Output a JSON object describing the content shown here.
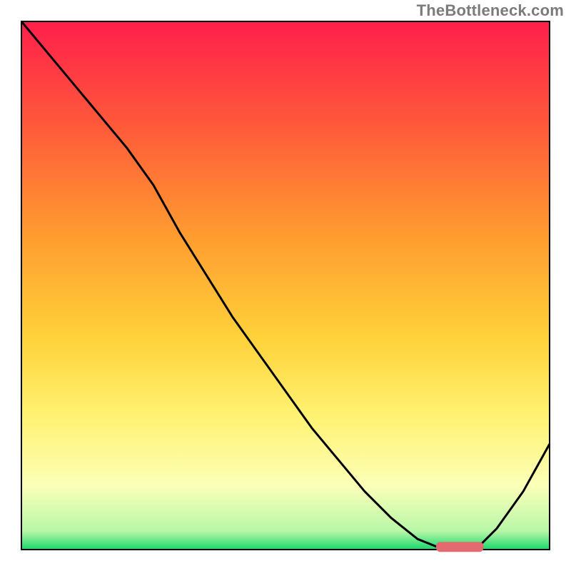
{
  "watermark": "TheBottleneck.com",
  "chart_data": {
    "type": "line",
    "description": "Bottleneck curve over a red-to-green vertical gradient. Lower y = better (green zone at bottom). Curve starts high at x=0, drops to a minimum plateau near x≈0.80–0.86, then rises again toward x=1.",
    "xlim": [
      0,
      1
    ],
    "ylim": [
      0,
      1
    ],
    "xlabel": "",
    "ylabel": "",
    "title": "",
    "series": [
      {
        "name": "bottleneck-curve",
        "x": [
          0.0,
          0.05,
          0.1,
          0.15,
          0.2,
          0.25,
          0.3,
          0.35,
          0.4,
          0.45,
          0.5,
          0.55,
          0.6,
          0.65,
          0.7,
          0.75,
          0.8,
          0.83,
          0.86,
          0.9,
          0.95,
          1.0
        ],
        "y": [
          1.0,
          0.94,
          0.88,
          0.82,
          0.76,
          0.69,
          0.6,
          0.52,
          0.44,
          0.37,
          0.3,
          0.23,
          0.17,
          0.11,
          0.06,
          0.02,
          0.0,
          0.0,
          0.0,
          0.04,
          0.11,
          0.2
        ]
      }
    ],
    "marker": {
      "name": "optimal-zone",
      "x_center": 0.83,
      "x_width": 0.09,
      "y": 0.005,
      "color": "#e46a6f"
    },
    "gradient_stops_top_to_bottom": [
      {
        "offset": 0.0,
        "color": "#ff1f4b"
      },
      {
        "offset": 0.2,
        "color": "#ff5a3a"
      },
      {
        "offset": 0.4,
        "color": "#ff9a2f"
      },
      {
        "offset": 0.6,
        "color": "#ffd23a"
      },
      {
        "offset": 0.75,
        "color": "#fff373"
      },
      {
        "offset": 0.88,
        "color": "#fbffb8"
      },
      {
        "offset": 0.965,
        "color": "#b8f7a8"
      },
      {
        "offset": 1.0,
        "color": "#17d86b"
      }
    ],
    "border_color": "#000000",
    "curve_color": "#000000"
  }
}
